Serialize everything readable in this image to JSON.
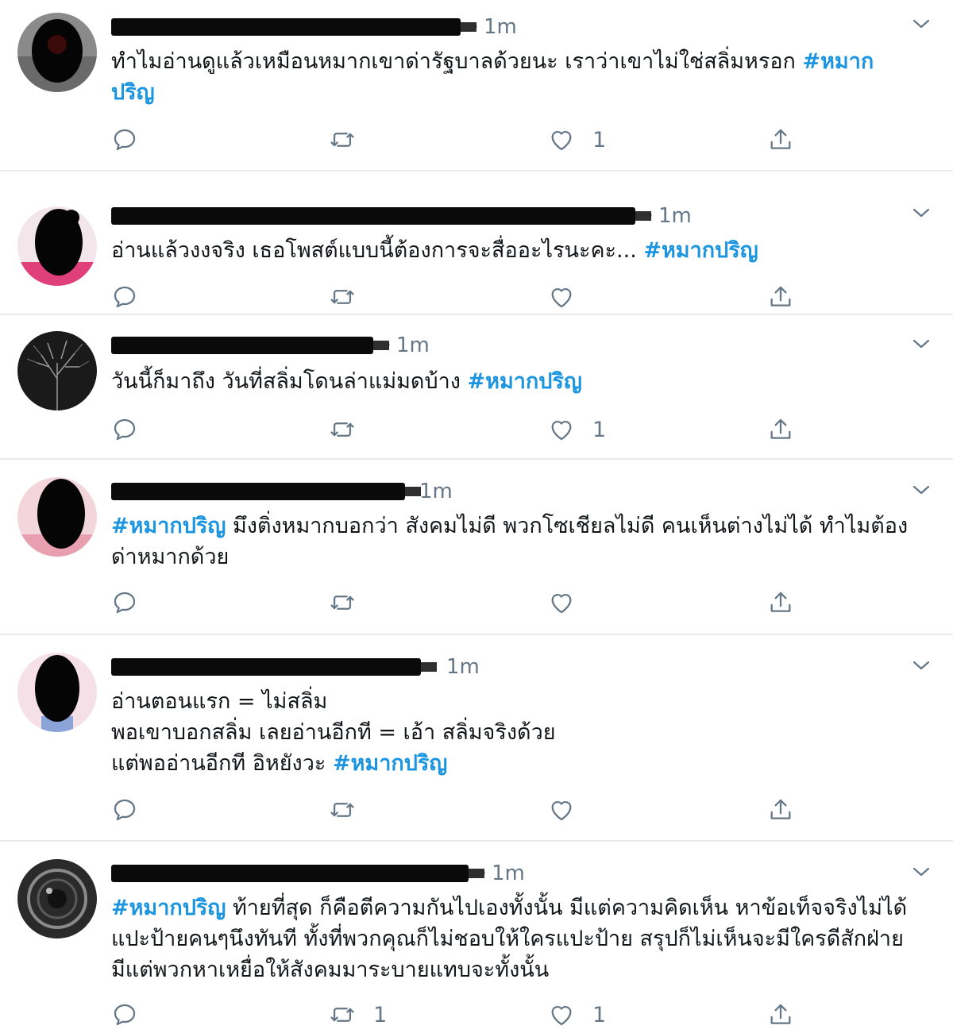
{
  "colors": {
    "hashtag": "#1b95e0",
    "muted": "#657786",
    "divider": "#e6ecf0"
  },
  "tweets": [
    {
      "time": "1m",
      "text": "ทำไมอ่านดูแล้วเหมือนหมากเขาด่ารัฐบาลด้วยนะ เราว่าเขาไม่ใช่สลิ่มหรอก ",
      "hashtag": "#หมาก ปริญ",
      "reply_count": "",
      "retweet_count": "",
      "like_count": "1"
    },
    {
      "time": "1m",
      "text": "อ่านแล้วงงจริง เธอโพสต์แบบนี้ต้องการจะสื่ออะไรนะคะ... ",
      "hashtag": "#หมากปริญ",
      "reply_count": "",
      "retweet_count": "",
      "like_count": ""
    },
    {
      "time": "1m",
      "text": "วันนี้ก็มาถึง วันที่สลิ่มโดนล่าแม่มดบ้าง ",
      "hashtag": "#หมากปริญ",
      "reply_count": "",
      "retweet_count": "",
      "like_count": "1"
    },
    {
      "time": "1m",
      "hashtag": "#หมากปริญ",
      "text": " มึงติ่งหมากบอกว่า สังคมไม่ดี พวกโซเชียลไม่ดี คนเห็นต่างไม่ได้ ทำไมต้องด่าหมากด้วย",
      "reply_count": "",
      "retweet_count": "",
      "like_count": ""
    },
    {
      "time": "1m",
      "lines": [
        "อ่านตอนแรก = ไม่สลิ่ม",
        "พอเขาบอกสลิ่ม เลยอ่านอีกที = เอ้า สลิ่มจริงด้วย",
        "แต่พออ่านอีกที อิหยังวะ "
      ],
      "hashtag": "#หมากปริญ",
      "reply_count": "",
      "retweet_count": "",
      "like_count": ""
    },
    {
      "time": "1m",
      "hashtag": "#หมากปริญ",
      "text": " ท้ายที่สุด ก็คือตีความกันไปเองทั้งนั้น มีแต่ความคิดเห็น หาข้อเท็จจริงไม่ได้ แปะป้ายคนๆนึงทันที ทั้งที่พวกคุณก็ไม่ชอบให้ใครแปะป้าย สรุปก็ไม่เห็นจะมีใครดีสักฝ่าย มีแต่พวกหาเหยื่อให้สังคมมาระบายแทบจะทั้งนั้น",
      "reply_count": "",
      "retweet_count": "1",
      "like_count": "1"
    }
  ],
  "icons": {
    "reply": "reply-icon",
    "retweet": "retweet-icon",
    "like": "heart-icon",
    "share": "share-icon",
    "more": "chevron-down-icon"
  }
}
